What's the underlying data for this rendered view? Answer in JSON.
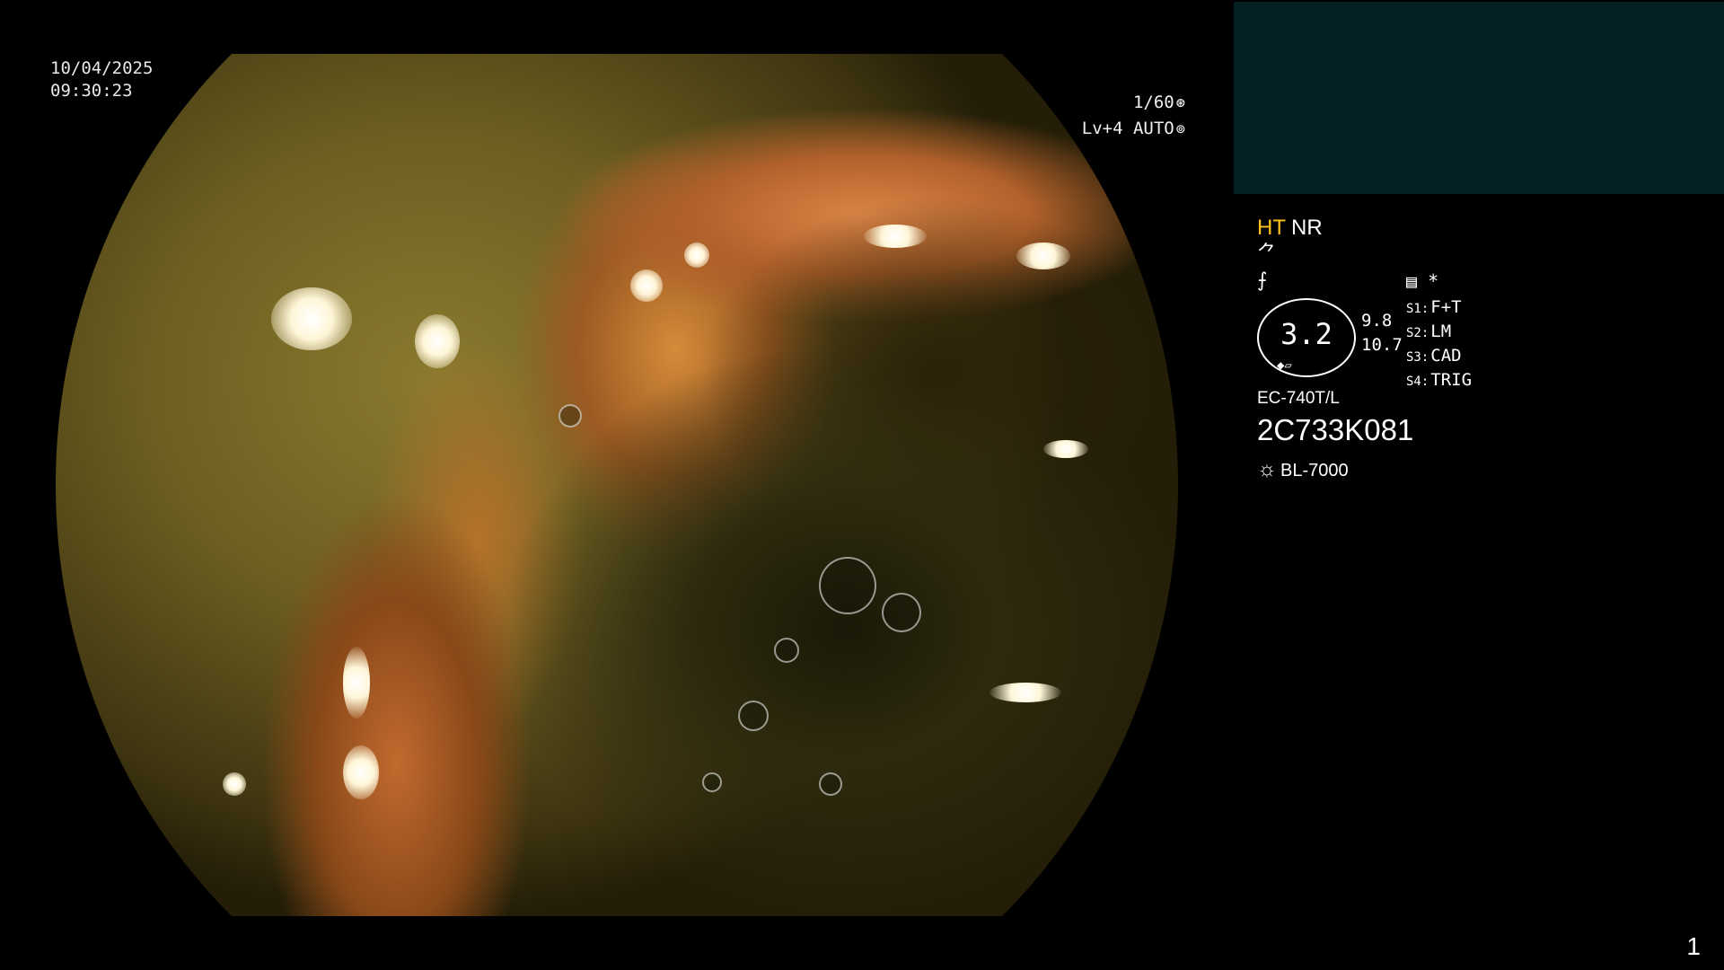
{
  "overlay": {
    "date": "10/04/2025",
    "time": "09:30:23",
    "exposure": "1/60",
    "exposure_icon": "shutter-icon",
    "level": "Lv+4 AUTO",
    "level_icon": "iris-icon"
  },
  "info_panel": {
    "mode_ht": "HT",
    "mode_nr": "NR",
    "color_ht": "#ffc21a",
    "icon_row_1": "⺈",
    "icon_row_2": "⨍",
    "icon_memo": "▤",
    "asterisk": "*",
    "gauge_value": "3.2",
    "gauge_nums": [
      "9.8",
      "10.7"
    ],
    "switches": [
      {
        "key": "S1:",
        "value": "F+T"
      },
      {
        "key": "S2:",
        "value": "LM"
      },
      {
        "key": "S3:",
        "value": "CAD"
      },
      {
        "key": "S4:",
        "value": "TRIG"
      }
    ],
    "scope_model": "EC-740T/L",
    "scope_serial": "2C733K081",
    "light_source": "BL-7000",
    "light_icon": "sun-icon"
  },
  "page_number": "1",
  "colors": {
    "background": "#000000",
    "top_panel": "#042022"
  }
}
